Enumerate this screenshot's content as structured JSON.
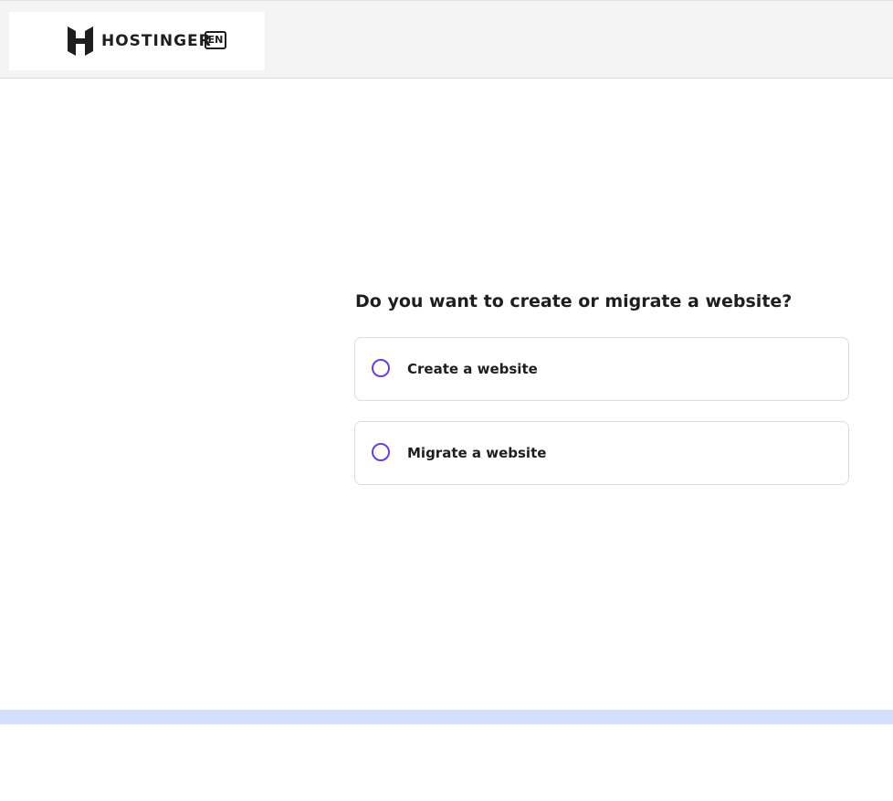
{
  "header": {
    "brand": "HOSTINGER",
    "language": "EN",
    "logo_icon": "hostinger-h-logo"
  },
  "main": {
    "question": "Do you want to create or migrate a website?",
    "options": [
      {
        "label": "Create a website",
        "selected": false
      },
      {
        "label": "Migrate a website",
        "selected": false
      }
    ]
  },
  "colors": {
    "accent": "#673de6",
    "text": "#1d1e20",
    "header_bg": "#f4f4f4",
    "strip": "#d5dffc"
  }
}
